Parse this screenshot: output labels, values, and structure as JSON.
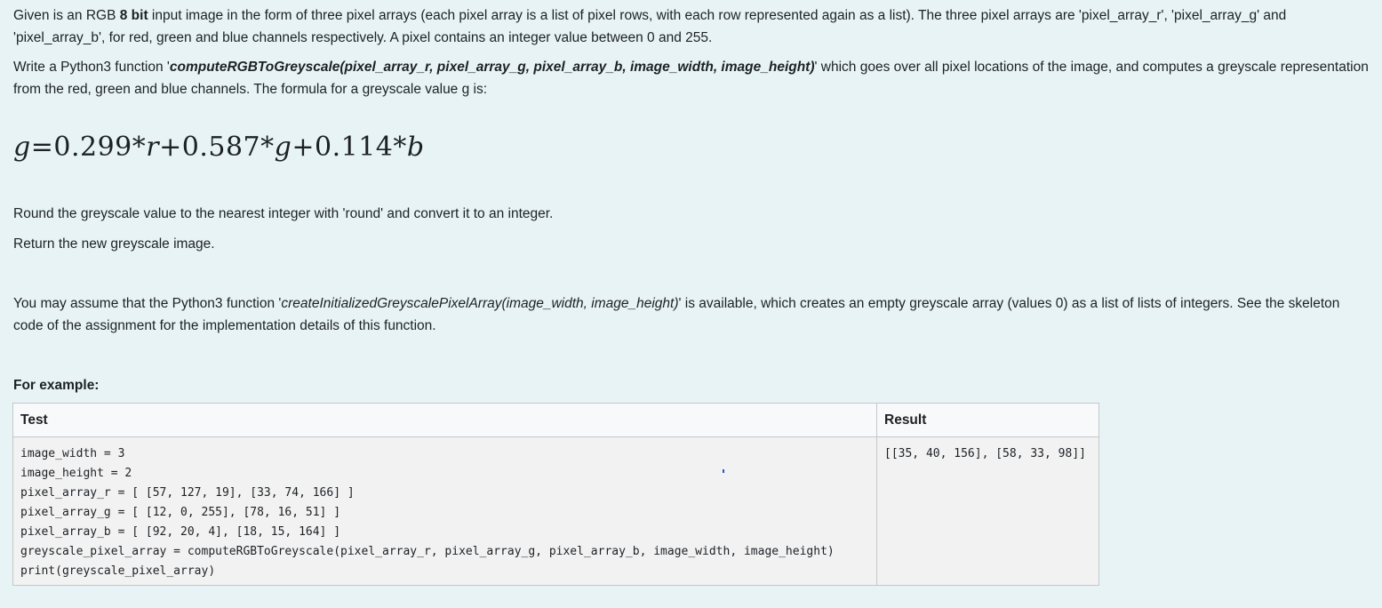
{
  "question": {
    "p1_a": "Given is an RGB ",
    "p1_bold": "8 bit",
    "p1_b": " input image in the form of three pixel arrays (each pixel array is a list of pixel rows, with each row represented again as a list). The three pixel arrays are 'pixel_array_r', 'pixel_array_g' and 'pixel_array_b', for red, green and blue channels respectively. A pixel contains an integer value between 0 and 255.",
    "p2_a": "Write a Python3 function '",
    "p2_func": "computeRGBToGreyscale(pixel_array_r, pixel_array_g, pixel_array_b, image_width, image_height)",
    "p2_b": "' which goes over all pixel locations of the image, and computes a greyscale representation from the red, green and blue channels. The formula for a greyscale value g is:",
    "formula": {
      "g": "g",
      "eq": "=0.299*",
      "r": "r",
      "plus1": "+0.587*",
      "g2": "g",
      "plus2": "+0.114*",
      "b": "b"
    },
    "p3": "Round the greyscale value to the nearest integer with 'round' and convert it to an integer.",
    "p4": "Return the new greyscale image.",
    "p5_a": "You may assume that the Python3 function '",
    "p5_func": "createInitializedGreyscalePixelArray(image_width, image_height)",
    "p5_b": "' is available, which creates an empty greyscale array (values 0) as a list of lists of integers. See the skeleton code of the assignment for the implementation details of this function."
  },
  "example": {
    "label": "For example:",
    "headers": {
      "test": "Test",
      "result": "Result"
    },
    "test_code": "image_width = 3\nimage_height = 2\npixel_array_r = [ [57, 127, 19], [33, 74, 166] ]\npixel_array_g = [ [12, 0, 255], [78, 16, 51] ]\npixel_array_b = [ [92, 20, 4], [18, 15, 164] ]\ngreyscale_pixel_array = computeRGBToGreyscale(pixel_array_r, pixel_array_g, pixel_array_b, image_width, image_height)\nprint(greyscale_pixel_array)",
    "result": "[[35, 40, 156], [58, 33, 98]]"
  },
  "colors": {
    "background": "#e7f3f5",
    "text": "#1d2125",
    "table_header_bg": "#f8f9fa",
    "table_cell_bg": "#f2f2f2",
    "table_border": "#c4c7ca"
  }
}
